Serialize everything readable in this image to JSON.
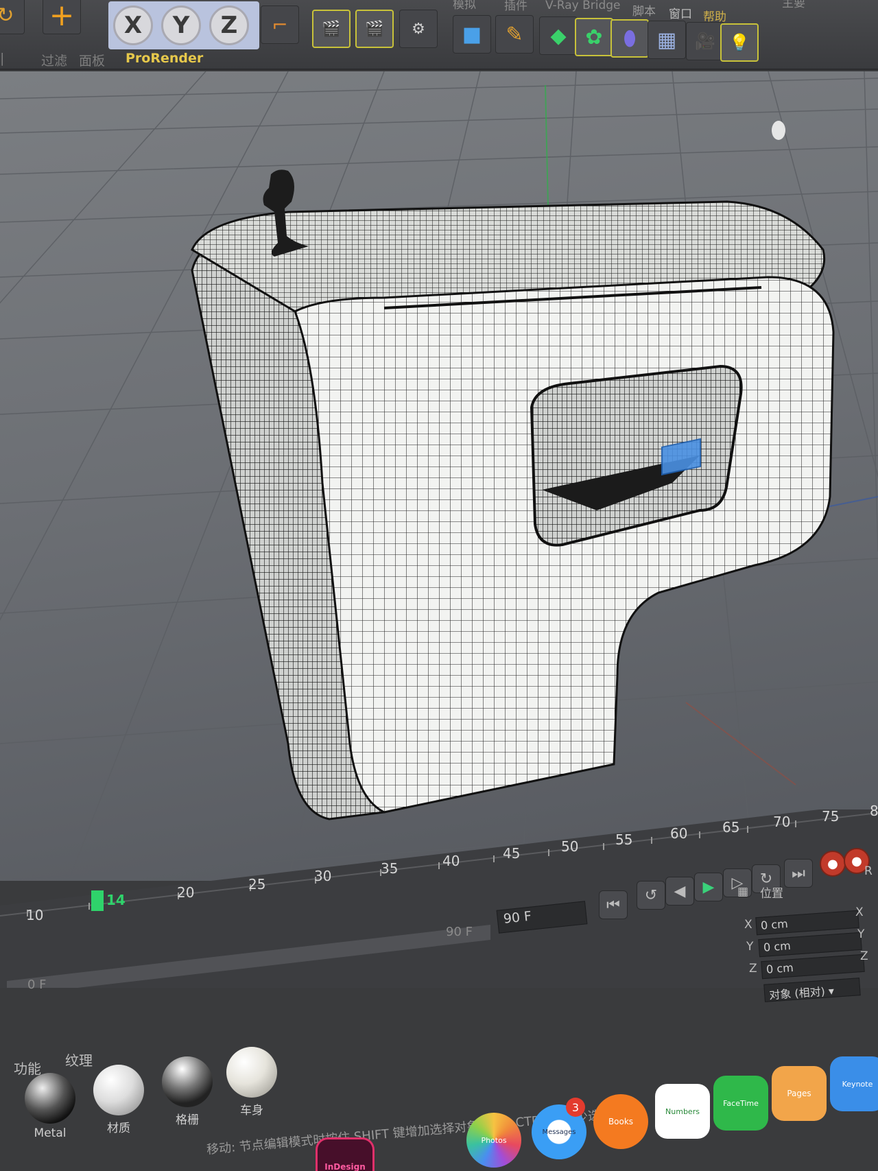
{
  "menu": {
    "items": [
      "模拟",
      "插件",
      "V-Ray Bridge",
      "脚本",
      "窗口",
      "帮助",
      "主要"
    ]
  },
  "toolbar": {
    "x_label": "X",
    "y_label": "Y",
    "z_label": "Z",
    "plus": "+"
  },
  "submenu": {
    "items": [
      "过滤",
      "面板",
      "ProRender"
    ]
  },
  "timeline": {
    "ticks": [
      "10",
      "20",
      "25",
      "30",
      "35",
      "40",
      "45",
      "50",
      "55",
      "60",
      "65",
      "70",
      "75",
      "8"
    ],
    "current_frame": "14",
    "end_frame": "90 F",
    "end_frame_field": "90 F",
    "start_frame": "0 F"
  },
  "coords": {
    "header": "位置",
    "labels": [
      "X",
      "Y",
      "Z"
    ],
    "values": [
      "0 cm",
      "0 cm",
      "0 cm"
    ],
    "mode": "对象 (相对)",
    "right_labels": [
      "X",
      "Y",
      "Z"
    ],
    "right_header": "R"
  },
  "materials": {
    "tabs": [
      "功能",
      "纹理"
    ],
    "items": [
      "Metal",
      "材质",
      "格栅",
      "车身"
    ]
  },
  "status": {
    "text": "节点编辑模式时按住 SHIFT 键增加选择对象; 按住 CTRL 键减少选择对象。",
    "prefix": "移动:"
  },
  "dock": {
    "messages_badge": "3",
    "app_labels": [
      "InDesign",
      "Photos",
      "Messages",
      "Books",
      "Numbers",
      "FaceTime",
      "Pages",
      "Keynote"
    ]
  },
  "colors": {
    "accent_yellow": "#e6c84b",
    "record_red": "#c23a2a",
    "keyframe_green": "#2fd36b",
    "play_green": "#3ad17a"
  }
}
